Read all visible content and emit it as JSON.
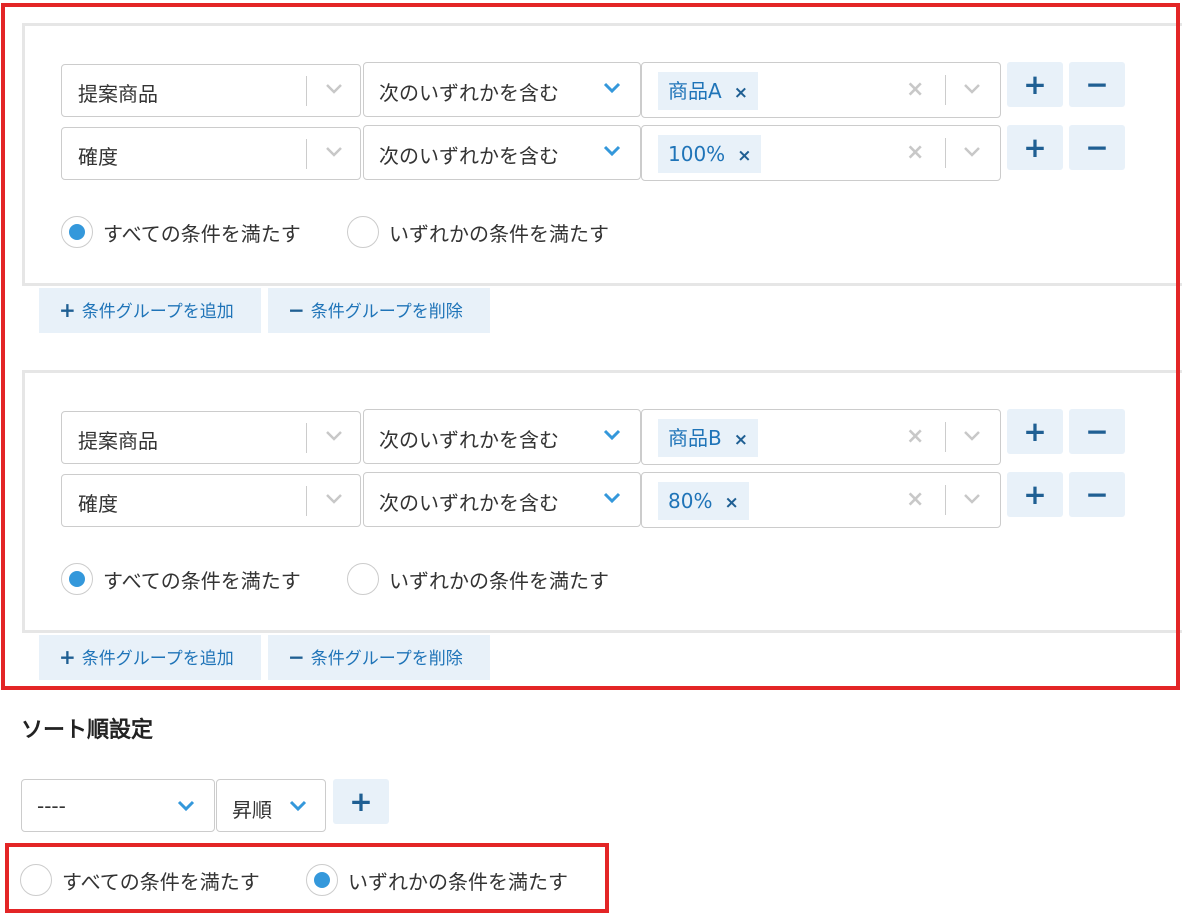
{
  "condition_groups": [
    {
      "rows": [
        {
          "field": "提案商品",
          "operator": "次のいずれかを含む",
          "tag": "商品A"
        },
        {
          "field": "確度",
          "operator": "次のいずれかを含む",
          "tag": "100%"
        }
      ],
      "match_all_label": "すべての条件を満たす",
      "match_any_label": "いずれかの条件を満たす",
      "selected": "all"
    },
    {
      "rows": [
        {
          "field": "提案商品",
          "operator": "次のいずれかを含む",
          "tag": "商品B"
        },
        {
          "field": "確度",
          "operator": "次のいずれかを含む",
          "tag": "80%"
        }
      ],
      "match_all_label": "すべての条件を満たす",
      "match_any_label": "いずれかの条件を満たす",
      "selected": "all"
    }
  ],
  "group_buttons": {
    "add_label": "条件グループを追加",
    "delete_label": "条件グループを削除",
    "add_icon": "+",
    "delete_icon": "−"
  },
  "row_buttons": {
    "add": "+",
    "remove": "−"
  },
  "tag_remove": "×",
  "clear_icon": "×",
  "sort": {
    "title": "ソート順設定",
    "field_value": "----",
    "order_value": "昇順",
    "add": "+",
    "match_all_label": "すべての条件を満たす",
    "match_any_label": "いずれかの条件を満たす",
    "selected": "any"
  },
  "colors": {
    "highlight": "#e32526",
    "accent": "#3498db",
    "tag_bg": "#e8f1f9",
    "tag_text": "#1f74b8"
  }
}
